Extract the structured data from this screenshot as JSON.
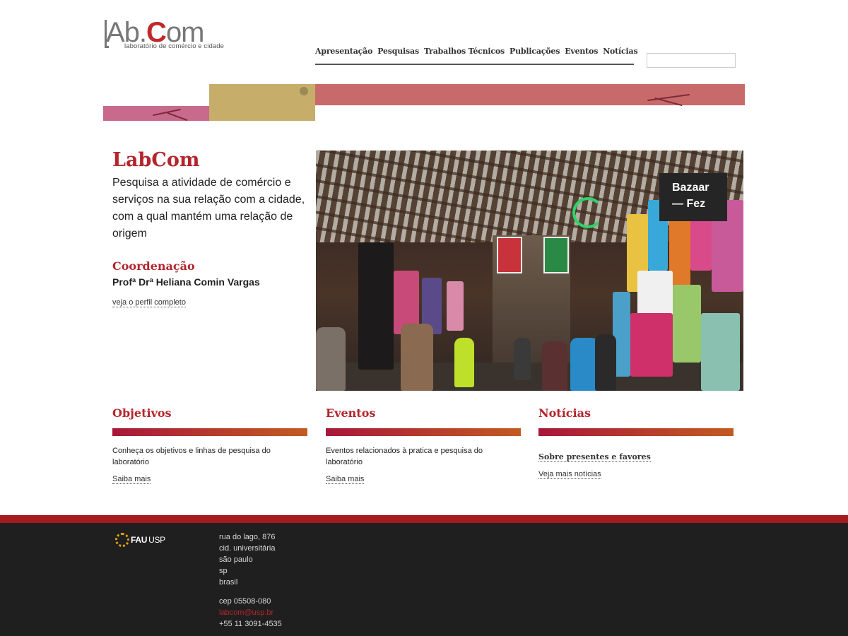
{
  "logo": {
    "word_left": "Ab.",
    "word_red": "C",
    "word_right": "om",
    "tagline": "laboratório de comércio e cidade"
  },
  "nav": {
    "items": [
      "Apresentação",
      "Pesquisas",
      "Trabalhos Técnicos",
      "Publicações",
      "Eventos",
      "Notícias"
    ]
  },
  "search": {
    "value": ""
  },
  "intro": {
    "title": "LabCom",
    "text": "Pesquisa a atividade de comércio e serviços na sua relação com a cidade, com a qual mantém uma relação de origem",
    "coord_title": "Coordenação",
    "coord_name": "Profª Drª Heliana Comin Vargas",
    "profile_link": "veja o perfil completo"
  },
  "photo": {
    "caption_line1": "Bazaar",
    "caption_line2": "— Fez"
  },
  "columns": [
    {
      "title": "Objetivos",
      "desc": "Conheça os objetivos e linhas de pesquisa do laboratório",
      "link": "Saiba mais"
    },
    {
      "title": "Eventos",
      "desc": "Eventos relacionados à pratica e pesquisa do laboratório",
      "link": "Saiba mais"
    },
    {
      "title": "Notícias",
      "item": "Sobre presentes e favores",
      "link": "Veja mais notícias"
    }
  ],
  "footer": {
    "brand_fau": "FAU",
    "brand_usp": "USP",
    "address": [
      "rua do lago, 876",
      "cid. universitária",
      "são paulo",
      "sp",
      "brasil"
    ],
    "cep": "cep 05508-080",
    "email": "labcom@usp.br",
    "phone": "+55 11 3091-4535"
  },
  "colors": {
    "accent": "#b4252c",
    "footer_bg": "#1f1f1f",
    "footer_line": "#a6191e"
  }
}
